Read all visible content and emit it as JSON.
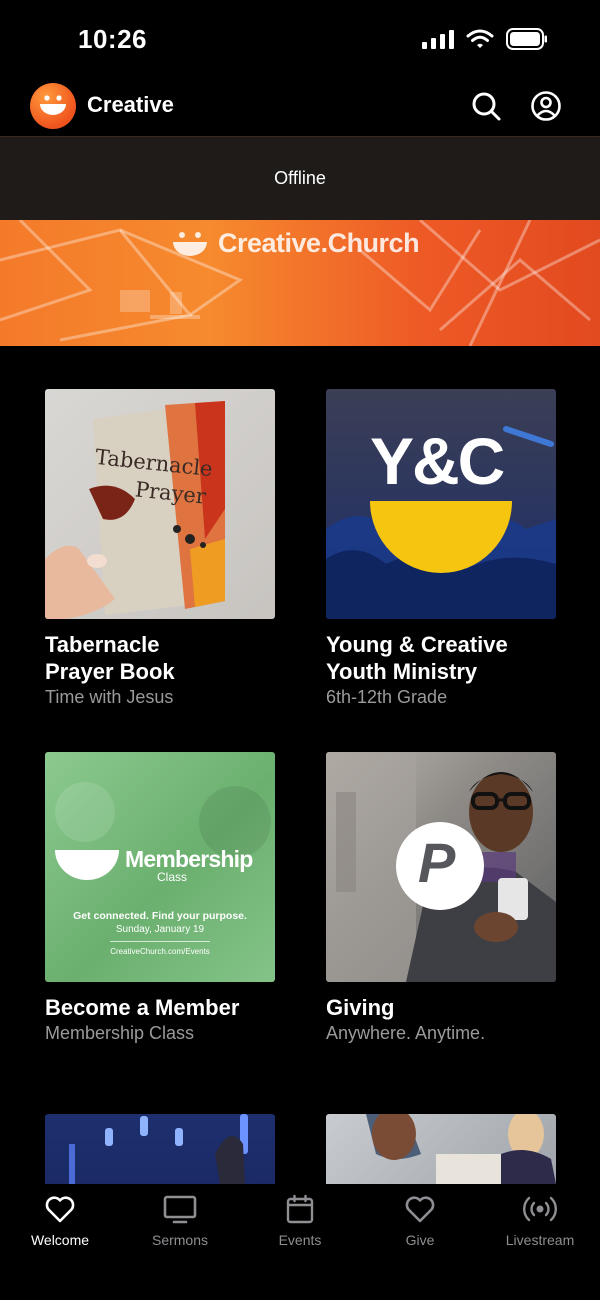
{
  "status_bar": {
    "time": "10:26"
  },
  "header": {
    "app_name": "Creative"
  },
  "offline_banner": {
    "text": "Offline"
  },
  "hero_banner": {
    "brand": "Creative.Church"
  },
  "cards": [
    {
      "title": "Tabernacle\nPrayer Book",
      "subtitle": "Time with Jesus",
      "thumb": {
        "line1": "Tabernacle",
        "line2": "Prayer"
      }
    },
    {
      "title": "Young & Creative\nYouth Ministry",
      "subtitle": "6th-12th Grade",
      "thumb": {
        "logo": "Y&C"
      }
    },
    {
      "title": "Become a Member",
      "subtitle": "Membership Class",
      "thumb": {
        "heading": "Membership",
        "sub": "Class",
        "line1": "Get connected. Find your purpose.",
        "line2": "Sunday, January 19",
        "line3": "CreativeChurch.com/Events"
      }
    },
    {
      "title": "Giving",
      "subtitle": "Anywhere. Anytime.",
      "thumb": {
        "badge": "P"
      }
    },
    {
      "title": "",
      "subtitle": ""
    },
    {
      "title": "",
      "subtitle": ""
    }
  ],
  "tabs": [
    {
      "label": "Welcome",
      "icon": "heart-icon",
      "active": true
    },
    {
      "label": "Sermons",
      "icon": "tv-icon",
      "active": false
    },
    {
      "label": "Events",
      "icon": "calendar-icon",
      "active": false
    },
    {
      "label": "Give",
      "icon": "heart-outline-icon",
      "active": false
    },
    {
      "label": "Livestream",
      "icon": "broadcast-icon",
      "active": false
    }
  ],
  "colors": {
    "accent": "#f26b22",
    "background": "#000000",
    "subtitle": "#9a9a9a",
    "tab_inactive": "#8e8e93"
  }
}
